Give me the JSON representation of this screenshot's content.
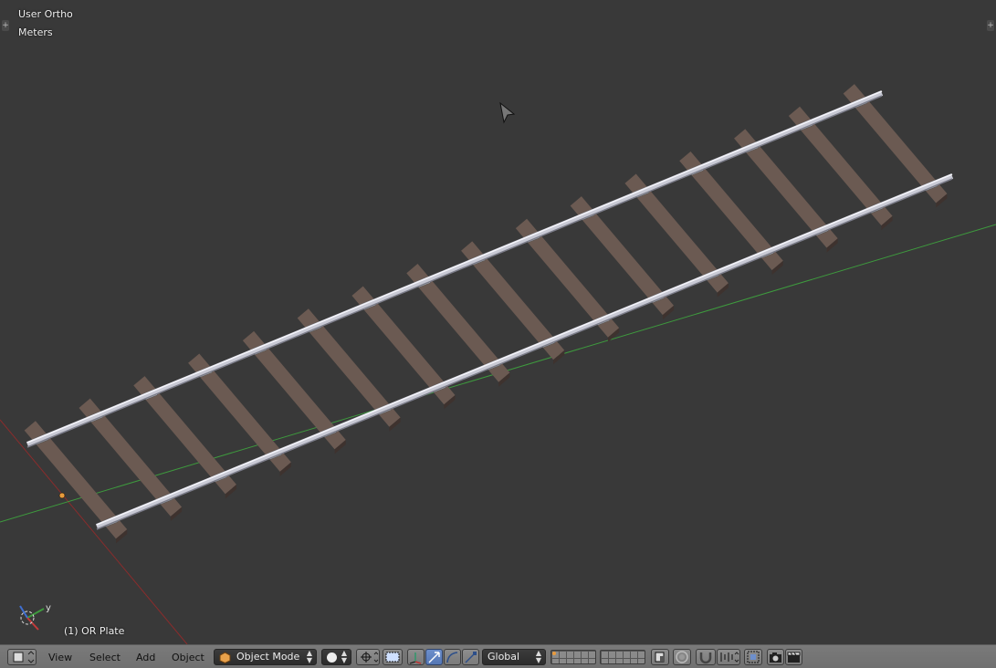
{
  "viewport": {
    "view_name": "User Ortho",
    "units": "Meters",
    "active_object": "(1) OR Plate",
    "axis_labels": {
      "y": "y"
    }
  },
  "header": {
    "menus": [
      "View",
      "Select",
      "Add",
      "Object"
    ],
    "mode": "Object Mode",
    "orientation": "Global"
  },
  "colors": {
    "background": "#393939",
    "sleeper": "#6b5a52",
    "rail": "#c8c9d4",
    "axis_x": "#8a2c2c",
    "axis_y": "#3e9a3e",
    "origin": "#e89a3c"
  },
  "icons": [
    "editor-type-icon",
    "object-mode-cube-icon",
    "shading-sphere-icon",
    "pivot-icon",
    "manipulator-icon",
    "translate-icon",
    "rotate-icon",
    "scale-icon",
    "layers-icon",
    "lock-icon",
    "proportional-icon",
    "snap-icon",
    "render-icon",
    "camera-icon",
    "clapper-icon"
  ]
}
